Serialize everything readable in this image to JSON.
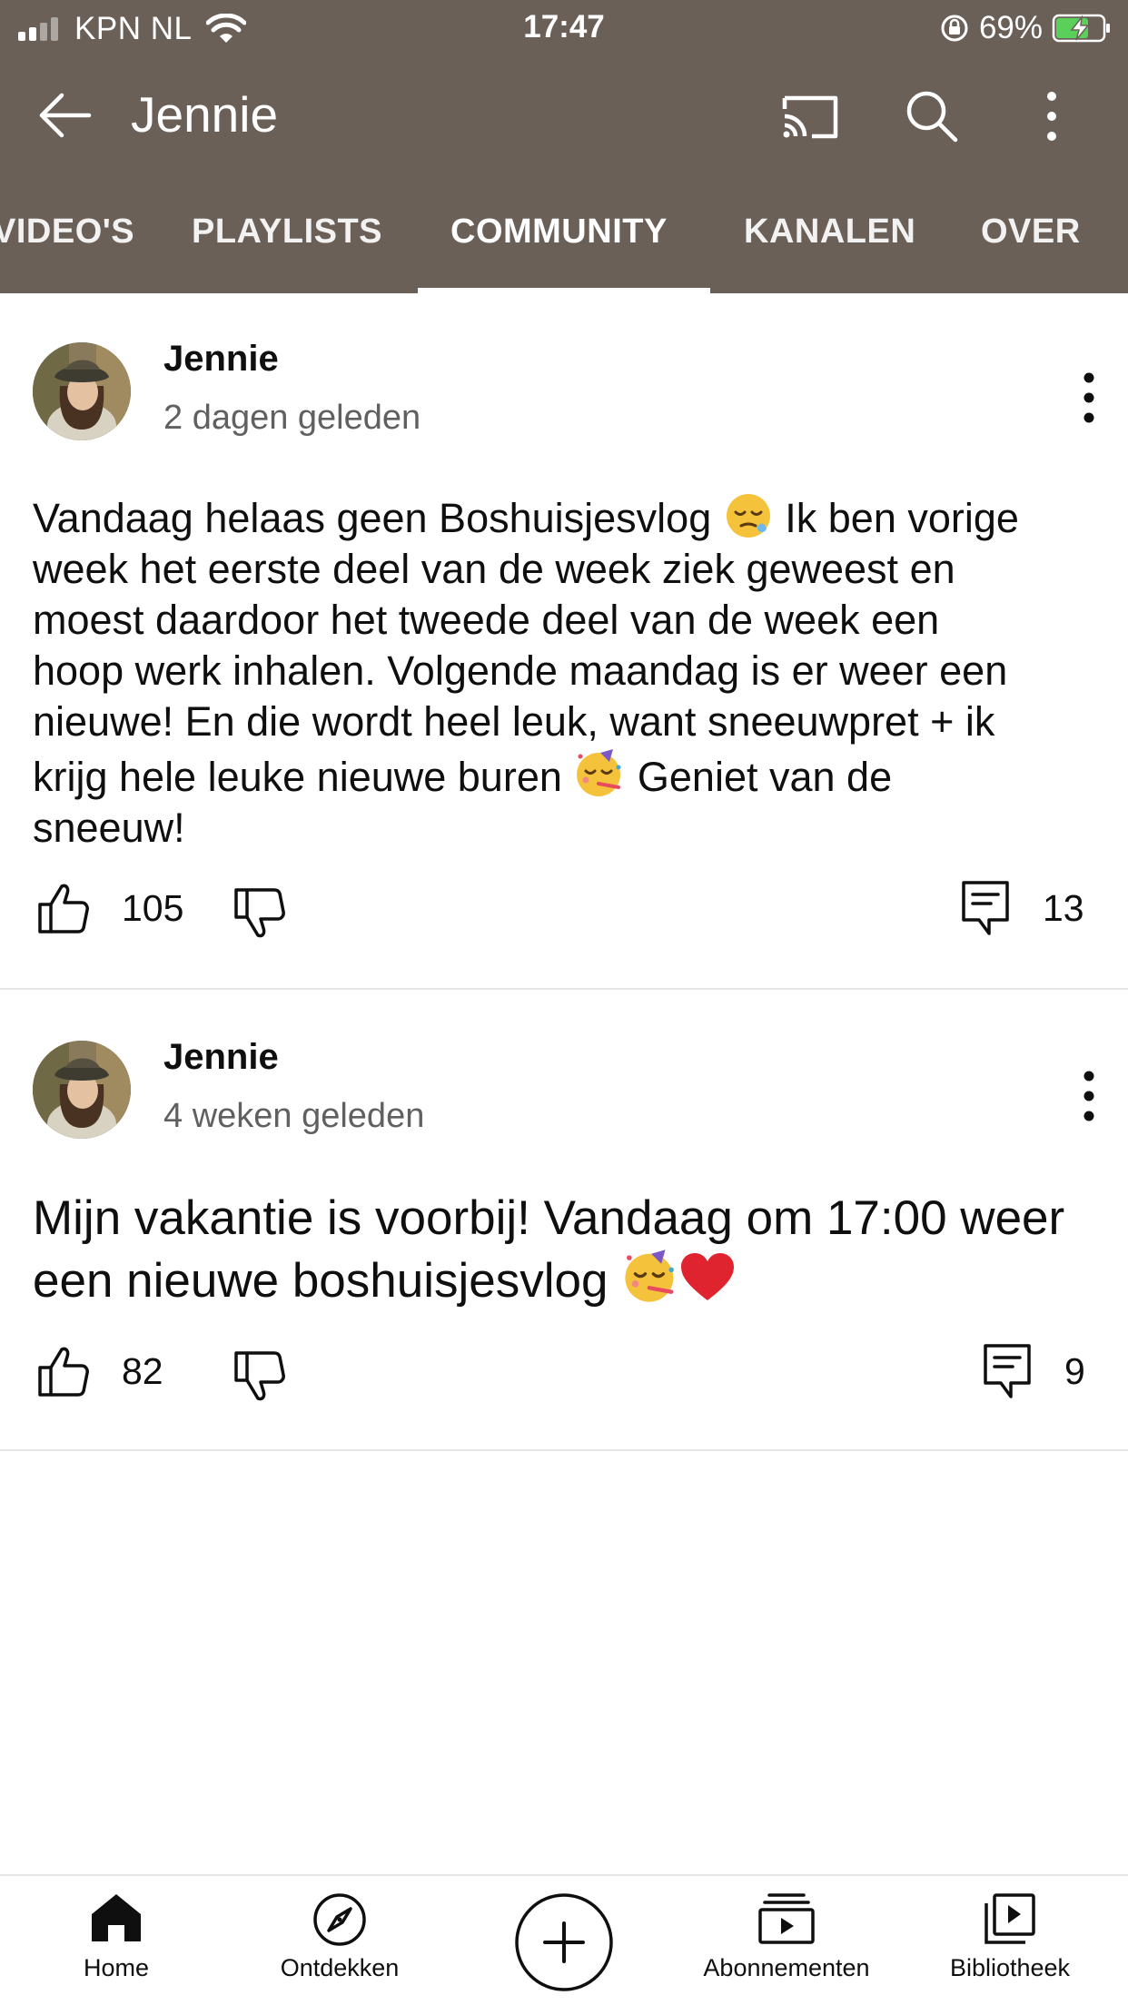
{
  "status_bar": {
    "carrier": "KPN NL",
    "time": "17:47",
    "battery": "69%",
    "battery_level": 0.69
  },
  "app_bar": {
    "title": "Jennie"
  },
  "tabs": [
    {
      "label": "VIDEO'S"
    },
    {
      "label": "PLAYLISTS"
    },
    {
      "label": "COMMUNITY",
      "active": true
    },
    {
      "label": "KANALEN"
    },
    {
      "label": "OVER"
    }
  ],
  "posts": [
    {
      "author": "Jennie",
      "time": "2 dagen geleden",
      "text_lines": [
        "Vandaag helaas geen Boshuisjesvlog",
        "Ik ben vorige",
        "week het eerste deel van de week ziek geweest en",
        "moest daardoor het tweede deel van de week een",
        "hoop werk inhalen. Volgende maandag is er weer een",
        "nieuwe! En die wordt heel leuk, want sneeuwpret + ik",
        "krijg hele leuke nieuwe buren",
        "Geniet van de",
        "sneeuw!"
      ],
      "likes": "105",
      "comments": "13"
    },
    {
      "author": "Jennie",
      "time": "4 weken geleden",
      "text_lines": [
        "Mijn vakantie is voorbij! Vandaag om 17:00 weer",
        "een nieuwe boshuisjesvlog"
      ],
      "likes": "82",
      "comments": "9"
    }
  ],
  "bottom_nav": [
    {
      "label": "Home",
      "icon": "home-icon",
      "active": true
    },
    {
      "label": "Ontdekken",
      "icon": "compass-icon"
    },
    {
      "label": "",
      "icon": "create-icon"
    },
    {
      "label": "Abonnementen",
      "icon": "subscriptions-icon"
    },
    {
      "label": "Bibliotheek",
      "icon": "library-icon"
    }
  ],
  "colors": {
    "header_bg": "#6b6058",
    "text_primary": "#0f0f0f",
    "text_secondary": "#606060",
    "battery_green": "#5ad05a"
  }
}
